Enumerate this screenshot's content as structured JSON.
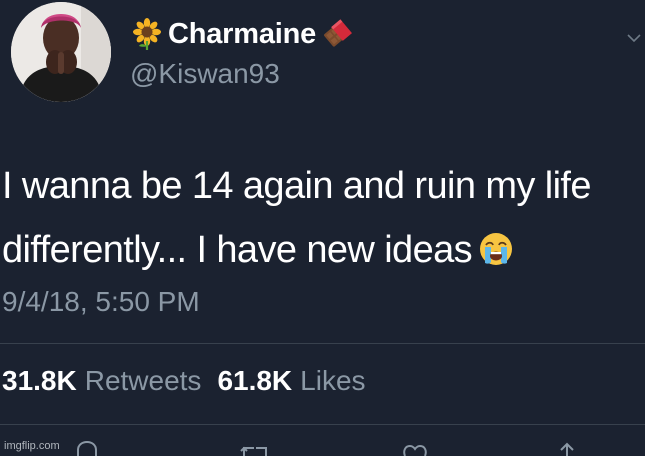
{
  "author": {
    "display_name": "Charmaine",
    "handle": "@Kiswan93",
    "name_prefix_icon": "sunflower-icon",
    "name_suffix_icon": "chocolate-bar-icon"
  },
  "tweet": {
    "text_line_1": "I wanna be 14 again and ruin my life",
    "text_line_2": "differently... I have new ideas",
    "trailing_emoji": "loudly-crying-face-icon",
    "timestamp": "9/4/18, 5:50 PM"
  },
  "stats": {
    "retweets_count": "31.8K",
    "retweets_label": "Retweets",
    "likes_count": "61.8K",
    "likes_label": "Likes"
  },
  "actions": [
    "reply-icon",
    "retweet-icon",
    "like-icon",
    "share-icon"
  ],
  "watermark": "imgflip.com",
  "colors": {
    "background": "#1b2230",
    "primary_text": "#ffffff",
    "secondary_text": "#8b98a5",
    "divider": "#38414d"
  }
}
